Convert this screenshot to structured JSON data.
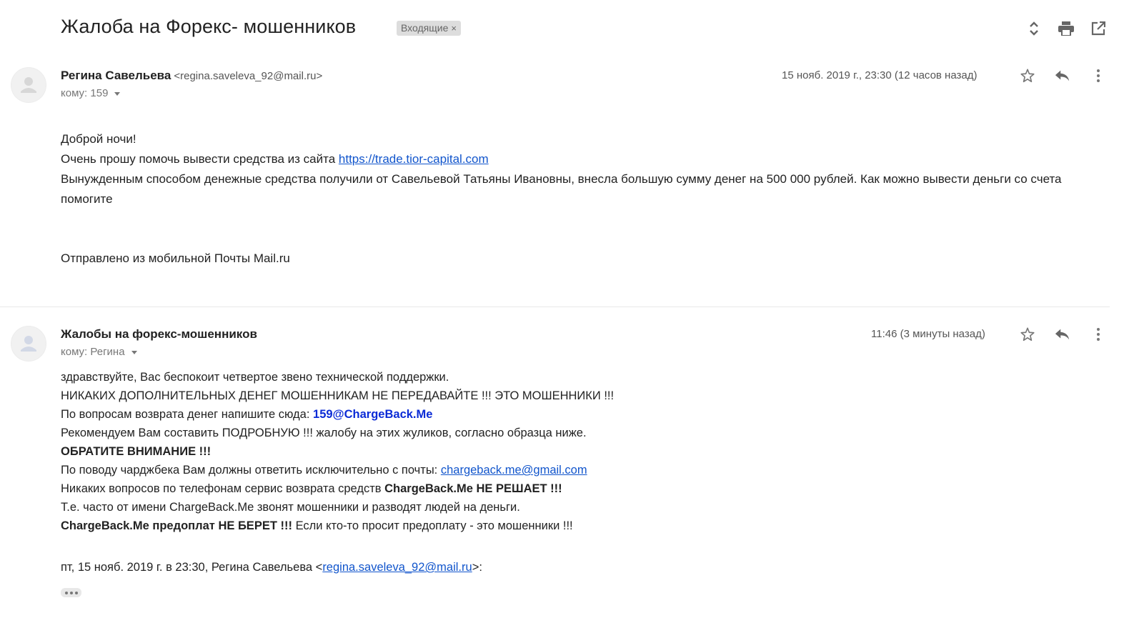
{
  "thread": {
    "subject": "Жалоба на Форекс- мошенников",
    "label": "Входящие",
    "label_remove": "×"
  },
  "toolbar_icons": [
    "expand-collapse-icon",
    "print-icon",
    "open-in-new-window-icon"
  ],
  "message1": {
    "sender_name": "Регина Савельева",
    "sender_email": "<regina.saveleva_92@mail.ru>",
    "to": "кому: 159",
    "date": "15 нояб. 2019 г., 23:30 (12 часов назад)",
    "body": {
      "greeting": "Доброй ночи!",
      "request_text": "Очень прошу помочь вывести средства из сайта ",
      "site_link": "https://trade.tior-capital.com",
      "paragraph": "Вынужденным способом денежные средства получили от Савельевой Татьяны Ивановны, внесла большую сумму денег на 500 000 рублей. Как можно вывести деньги со счета помогите",
      "signature": "Отправлено из мобильной Почты Mail.ru"
    }
  },
  "message2": {
    "sender_name": "Жалобы на форекс-мошенников",
    "to": "кому: Регина",
    "date": "11:46 (3 минуты назад)",
    "body": {
      "line1": "здравствуйте, Вас беспокоит четвертое звено технической поддержки.",
      "line2": "НИКАКИХ ДОПОЛНИТЕЛЬНЫХ ДЕНЕГ МОШЕННИКАМ НЕ ПЕРЕДАВАЙТЕ !!! ЭТО МОШЕННИКИ !!!",
      "line3_prefix": "По вопросам возврата денег напишите сюда: ",
      "line3_email": "159@ChargeBack.Me",
      "line4": "Рекомендуем Вам составить ПОДРОБНУЮ !!! жалобу на этих жуликов, согласно образца ниже.",
      "line5": "ОБРАТИТЕ ВНИМАНИЕ !!!",
      "line6_prefix": "По поводу чарджбека Вам должны ответить исключительно с почты: ",
      "line6_email": "chargeback.me@gmail.com",
      "line7_prefix": "Никаких вопросов по телефонам сервис возврата средств ",
      "line7_bold": "ChargeBack.Me НЕ РЕШАЕТ !!!",
      "line8": "Т.е. часто от имени ChargeBack.Me звонят мошенники и разводят людей на деньги.",
      "line9_bold": "ChargeBack.Me предоплат НЕ БЕРЕТ !!!",
      "line9_rest": " Если кто-то просит предоплату - это мошенники !!!",
      "quote_prefix": "пт, 15 нояб. 2019 г. в 23:30, Регина Савельева <",
      "quote_email": "regina.saveleva_92@mail.ru",
      "quote_suffix": ">:"
    }
  }
}
